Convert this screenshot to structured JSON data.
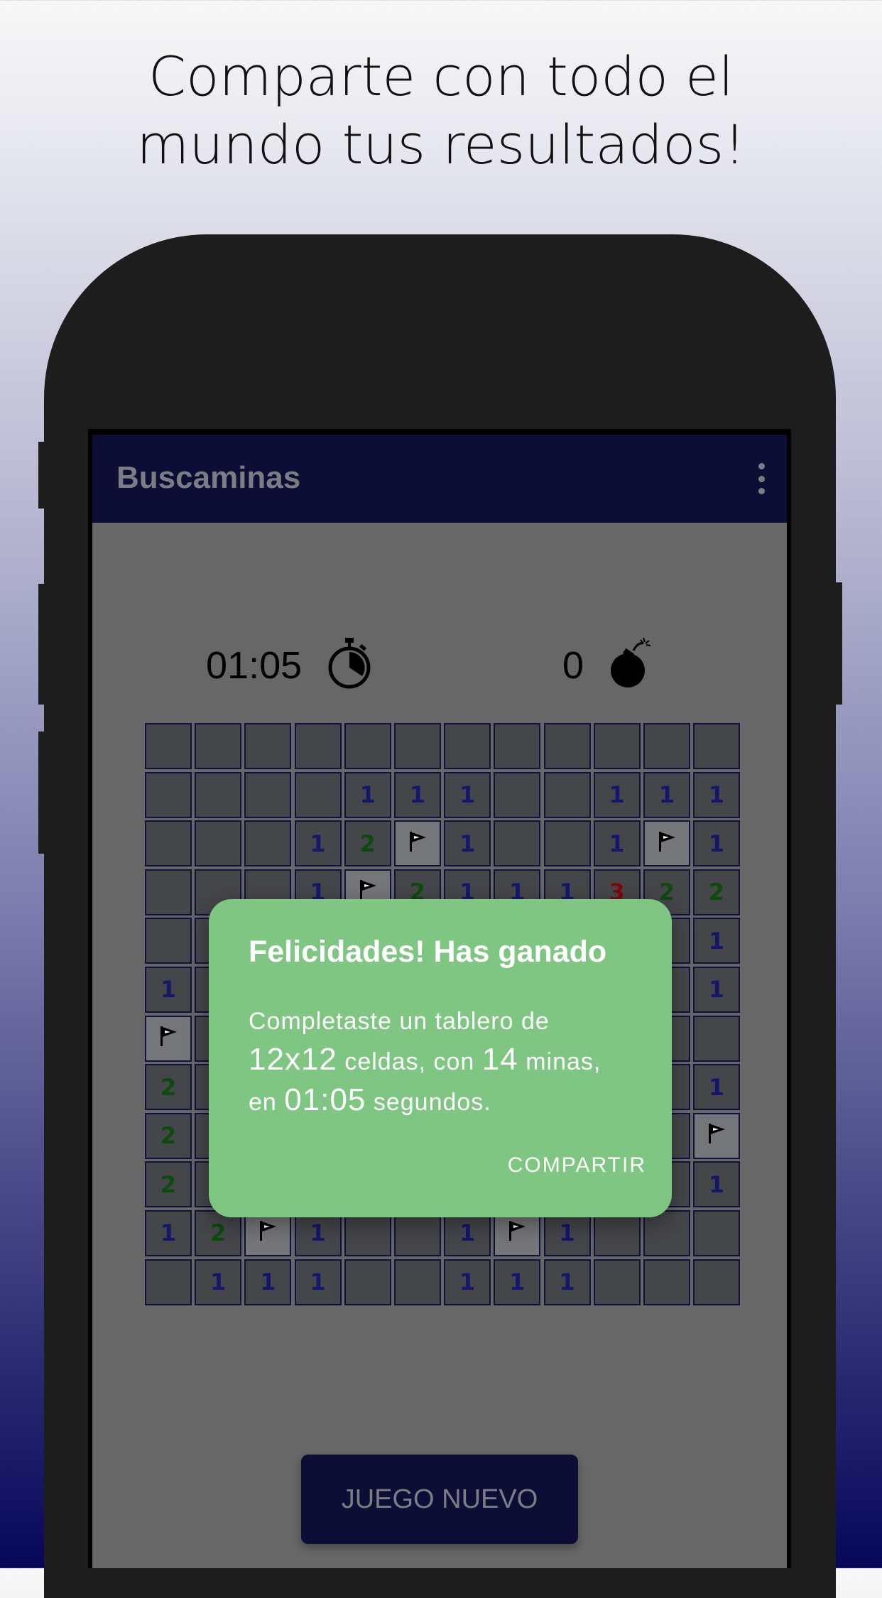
{
  "headline": {
    "line1": "Comparte con todo el",
    "line2": "mundo tus resultados!"
  },
  "appbar": {
    "title": "Buscaminas",
    "menu_icon": "more-vert-icon"
  },
  "status": {
    "timer": "01:05",
    "timer_icon": "stopwatch-icon",
    "mines": "0",
    "mines_icon": "bomb-icon"
  },
  "board": {
    "rows": [
      [
        "",
        "",
        "",
        "",
        "",
        "",
        "",
        "",
        "",
        "",
        "",
        ""
      ],
      [
        "",
        "",
        "",
        "",
        "1",
        "1",
        "1",
        "",
        "",
        "1",
        "1",
        "1"
      ],
      [
        "",
        "",
        "",
        "1",
        "2",
        "F",
        "1",
        "",
        "",
        "1",
        "F",
        "1"
      ],
      [
        "",
        "",
        "",
        "1",
        "F",
        "2",
        "1",
        "1",
        "1",
        "3",
        "2",
        "2"
      ],
      [
        "",
        "",
        "",
        "",
        "",
        "",
        "",
        "",
        "",
        "",
        "",
        "1"
      ],
      [
        "1",
        "",
        "",
        "",
        "",
        "",
        "",
        "",
        "",
        "",
        "",
        "1"
      ],
      [
        "F",
        "",
        "",
        "",
        "",
        "",
        "",
        "",
        "",
        "",
        "",
        ""
      ],
      [
        "2",
        "",
        "",
        "",
        "",
        "",
        "",
        "",
        "",
        "",
        "",
        "1"
      ],
      [
        "2",
        "",
        "",
        "",
        "",
        "",
        "",
        "",
        "",
        "",
        "",
        "F"
      ],
      [
        "2",
        "",
        "",
        "",
        "",
        "",
        "",
        "",
        "",
        "",
        "",
        "1"
      ],
      [
        "1",
        "2",
        "F",
        "1",
        "",
        "",
        "1",
        "F",
        "1",
        "",
        "",
        ""
      ],
      [
        "",
        "1",
        "1",
        "1",
        "",
        "",
        "1",
        "1",
        "1",
        "",
        "",
        ""
      ]
    ],
    "colors": {
      "1": "#15176a",
      "2": "#0d4a0d",
      "3": "#7a0b0b"
    }
  },
  "dialog": {
    "title": "Felicidades! Has ganado",
    "body_prefix": "Completaste un tablero de",
    "board_size": "12x12",
    "cells_word": "celdas, con",
    "mines_count": "14",
    "mines_word": "minas,",
    "in_word": "en",
    "time": "01:05",
    "seconds_word": "segundos.",
    "share_label": "COMPARTIR"
  },
  "new_game_label": "JUEGO NUEVO",
  "colors": {
    "appbar": "#0d0e35",
    "dialog": "#7fc682",
    "screen_bg": "#676767"
  }
}
